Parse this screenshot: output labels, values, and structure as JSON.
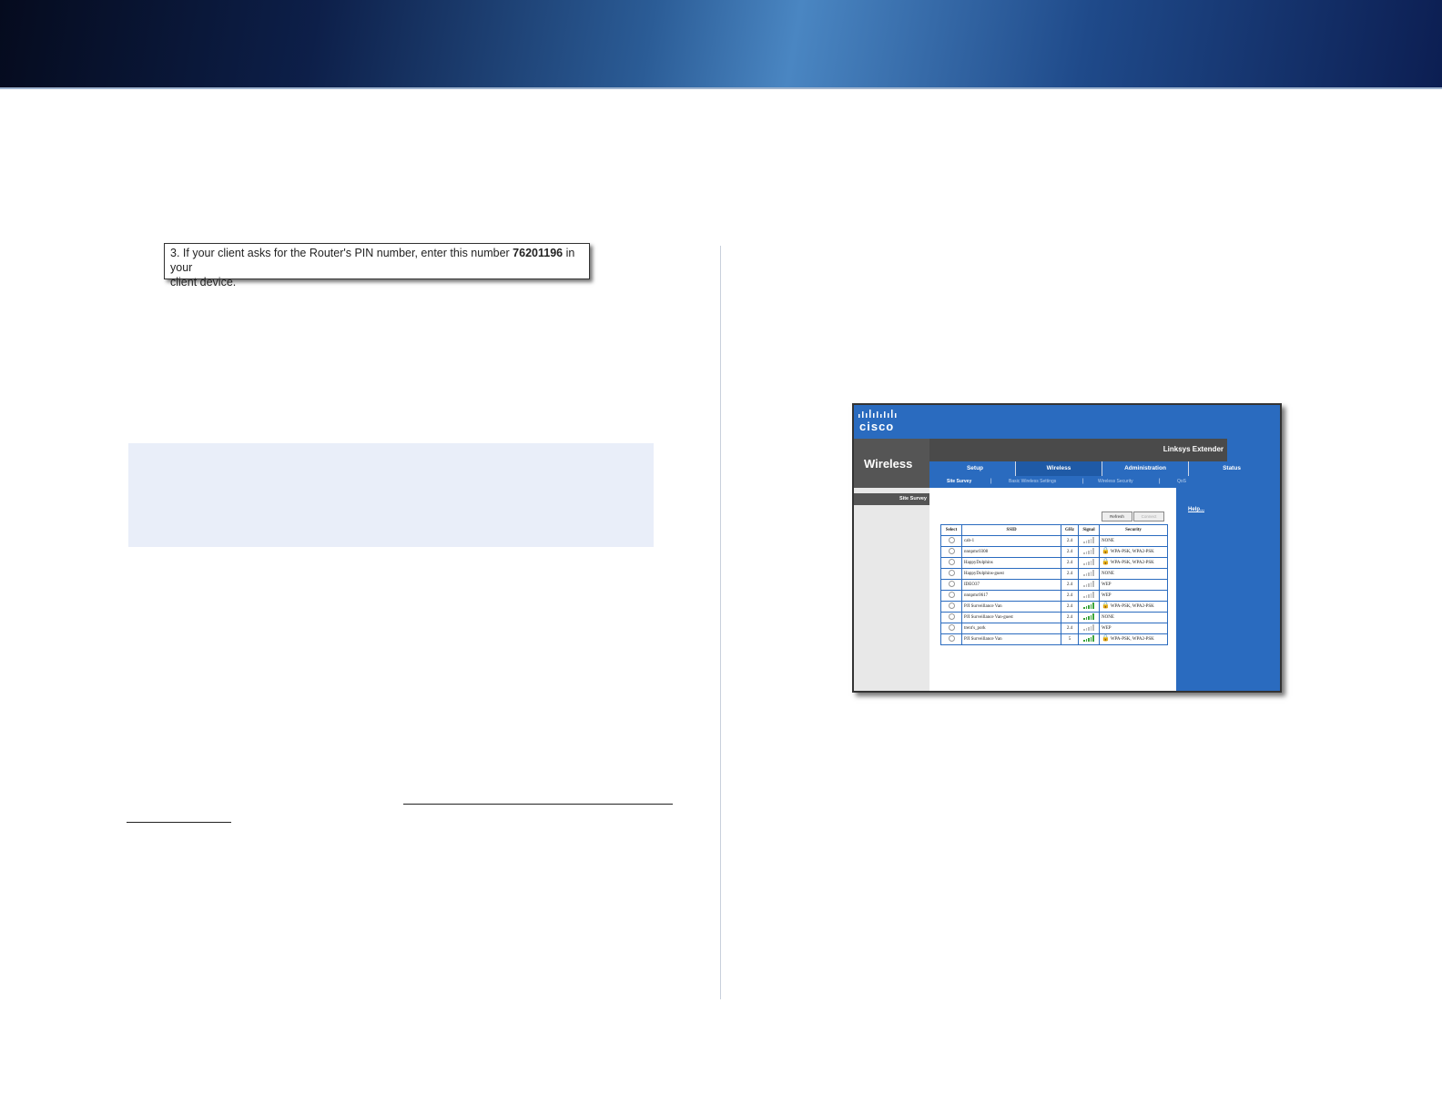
{
  "pin_instruction": {
    "prefix": "3. If your client asks for the Router's PIN number, enter this number ",
    "pin": "76201196",
    "suffix": " in your",
    "line2": "client device."
  },
  "router_ui": {
    "brand": "cisco",
    "section_title": "Wireless",
    "product_name": "Linksys Extender",
    "tabs": [
      "Setup",
      "Wireless",
      "Administration",
      "Status"
    ],
    "subtabs": [
      "Site Survey",
      "Basic Wireless Settings",
      "Wireless Security",
      "QoS"
    ],
    "left_menu_item": "Site Survey",
    "buttons": [
      "Refresh",
      "Connect"
    ],
    "help_link": "Help...",
    "table_headers": [
      "Select",
      "SSID",
      "GHz",
      "Signal",
      "Security"
    ],
    "rows": [
      {
        "ssid": "cab-1",
        "ghz": "2.4",
        "signal": "weak",
        "lock": false,
        "security": "NONE"
      },
      {
        "ssid": "nnnpmc0308",
        "ghz": "2.4",
        "signal": "weak",
        "lock": true,
        "security": "WPA-PSK, WPA2-PSK"
      },
      {
        "ssid": "HappyDolphins",
        "ghz": "2.4",
        "signal": "weak",
        "lock": true,
        "security": "WPA-PSK, WPA2-PSK"
      },
      {
        "ssid": "HappyDolphins-guest",
        "ghz": "2.4",
        "signal": "weak",
        "lock": false,
        "security": "NONE"
      },
      {
        "ssid": "IDEO37",
        "ghz": "2.4",
        "signal": "weak",
        "lock": false,
        "security": "WEP"
      },
      {
        "ssid": "nnnpmc0617",
        "ghz": "2.4",
        "signal": "weak",
        "lock": false,
        "security": "WEP"
      },
      {
        "ssid": "PJI Surveillance Van",
        "ghz": "2.4",
        "signal": "strong",
        "lock": true,
        "security": "WPA-PSK, WPA2-PSK"
      },
      {
        "ssid": "PJI Surveillance Van-guest",
        "ghz": "2.4",
        "signal": "strong",
        "lock": false,
        "security": "NONE"
      },
      {
        "ssid": "trent's_pork",
        "ghz": "2.4",
        "signal": "weak",
        "lock": false,
        "security": "WEP"
      },
      {
        "ssid": "PJI Surveillance Van",
        "ghz": "5",
        "signal": "strong",
        "lock": true,
        "security": "WPA-PSK, WPA2-PSK"
      }
    ]
  },
  "colors": {
    "accent_blue": "#2a6bbf",
    "note_bg": "#e9eef9",
    "signal_strong": "#3aa33a",
    "signal_weak": "#bbbbbb"
  }
}
